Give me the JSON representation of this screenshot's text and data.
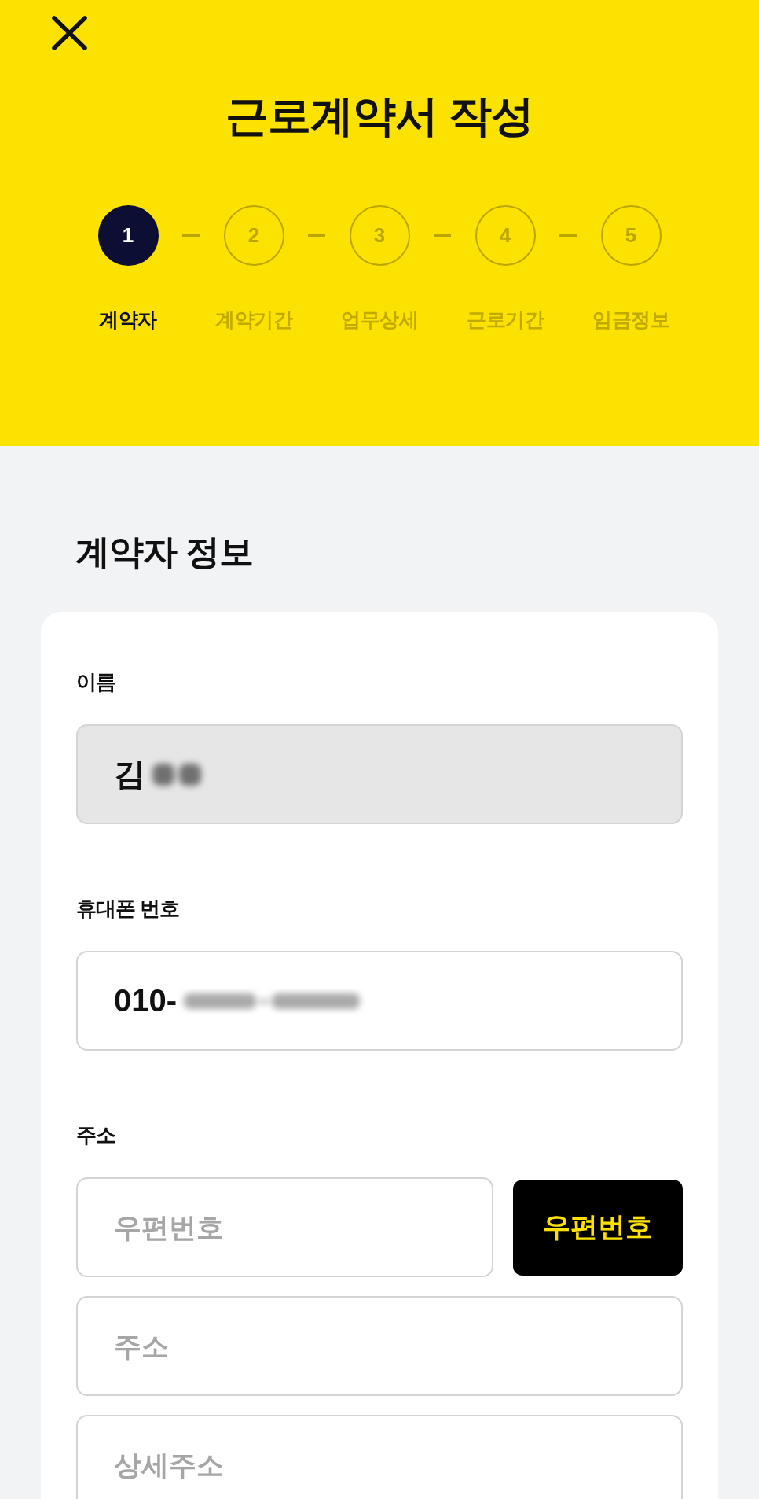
{
  "header": {
    "title": "근로계약서 작성",
    "steps": [
      {
        "number": "1",
        "label": "계약자",
        "selected": true
      },
      {
        "number": "2",
        "label": "계약기간",
        "selected": false
      },
      {
        "number": "3",
        "label": "업무상세",
        "selected": false
      },
      {
        "number": "4",
        "label": "근로기간",
        "selected": false
      },
      {
        "number": "5",
        "label": "임금정보",
        "selected": false
      }
    ]
  },
  "form": {
    "title": "계약자 정보",
    "fields": [
      {
        "kind": "name",
        "label": "이름",
        "value": "김",
        "disabled": true,
        "blurred": true
      },
      {
        "kind": "phone",
        "label": "휴대폰 번호",
        "value": "010-",
        "disabled": false,
        "blurred": true
      },
      {
        "kind": "address",
        "label": "주소",
        "disabled": false,
        "postcode": {
          "placeholder": "우편번호"
        },
        "search_button": "우편번호",
        "address": {
          "placeholder": "주소"
        },
        "detail": {
          "placeholder": "상세주소"
        }
      }
    ]
  }
}
